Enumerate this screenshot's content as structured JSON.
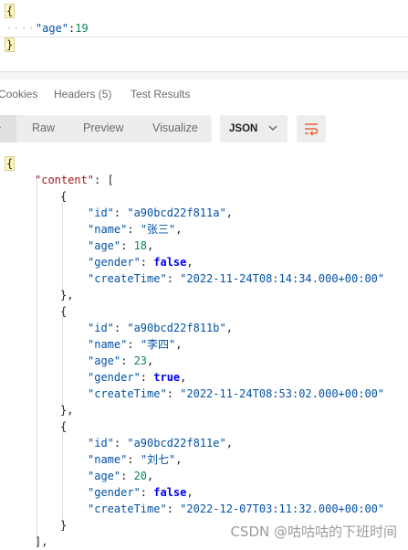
{
  "request_body": {
    "open": "{",
    "dots": "····",
    "key": "\"age\"",
    "colon": ":",
    "value": "19",
    "close": "}"
  },
  "tabs": [
    "Cookies",
    "Headers (5)",
    "Test Results"
  ],
  "view_modes": [
    "Raw",
    "Preview",
    "Visualize"
  ],
  "format": {
    "label": "JSON"
  },
  "icons": {
    "format_dropdown": "chevron-down-icon",
    "wrap": "wrap-lines-icon"
  },
  "response": {
    "open": "{",
    "content_key": "\"content\"",
    "items": [
      {
        "id": "\"a90bcd22f811a\"",
        "name": "\"张三\"",
        "age": "18",
        "gender": "false",
        "createTime": "\"2022-11-24T08:14:34.000+00:00\""
      },
      {
        "id": "\"a90bcd22f811b\"",
        "name": "\"李四\"",
        "age": "23",
        "gender": "true",
        "createTime": "\"2022-11-24T08:53:02.000+00:00\""
      },
      {
        "id": "\"a90bcd22f811e\"",
        "name": "\"刘七\"",
        "age": "20",
        "gender": "false",
        "createTime": "\"2022-12-07T03:11:32.000+00:00\""
      }
    ],
    "close_array": "],"
  },
  "watermark": "CSDN @咕咕咕的下班时间"
}
